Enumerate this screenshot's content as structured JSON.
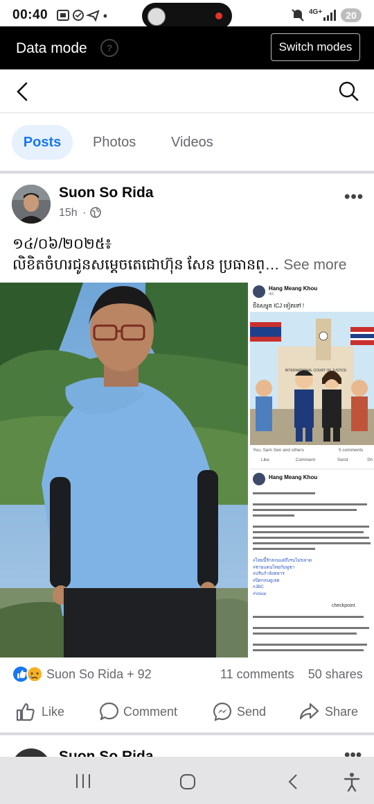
{
  "status_bar": {
    "time": "00:40",
    "network": "4G+",
    "battery": "20"
  },
  "data_mode": {
    "title": "Data mode",
    "help": "?",
    "switch_label": "Switch modes"
  },
  "tabs": [
    {
      "label": "Posts",
      "active": true
    },
    {
      "label": "Photos",
      "active": false
    },
    {
      "label": "Videos",
      "active": false
    }
  ],
  "post": {
    "author": "Suon So Rida",
    "time": "15h",
    "privacy_icon": "globe-icon",
    "line1": "១៤/០៦/២០២៥៖",
    "line2": "លិខិតចំហរជូនសម្តេចតេជោហ៊ុន សែន ប្រធានព្…",
    "see_more": " See more",
    "reactions_label": "Suon So Rida + 92",
    "comments": "11 comments",
    "shares": "50 shares"
  },
  "embedded_screenshot": {
    "author": "Hang Meang Khou",
    "time": "4d",
    "caption": "ចឹងសម្លុត ICJ ទៀតទៅ !",
    "court_sign": "INTERNATIONAL COURT OF JUSTICE",
    "reactors": "You, Sam Sen and others",
    "comments": "5 comments",
    "actions": [
      "Like",
      "Comment",
      "Send",
      "Sh"
    ],
    "author2": "Hang Meang Khou",
    "hashtags": [
      "#ไทยนี้รักสงบแต่ถึงรบไม่ขลาด",
      "#ชายแดนไทยกัมพูชา",
      "#ปรับกำลังทหาร",
      "#ปิดกลบดูเลต",
      "#JBC",
      "#Voice"
    ],
    "checkpoint": "checkpoint"
  },
  "actions": [
    {
      "label": "Like",
      "icon": "thumbs-up-icon"
    },
    {
      "label": "Comment",
      "icon": "comment-icon"
    },
    {
      "label": "Send",
      "icon": "messenger-icon"
    },
    {
      "label": "Share",
      "icon": "share-icon"
    }
  ],
  "next_post": {
    "author": "Suon So Rida"
  },
  "colors": {
    "accent": "#1877f2",
    "tab_bg": "#e7f0fd",
    "secondary_text": "#65676b"
  }
}
